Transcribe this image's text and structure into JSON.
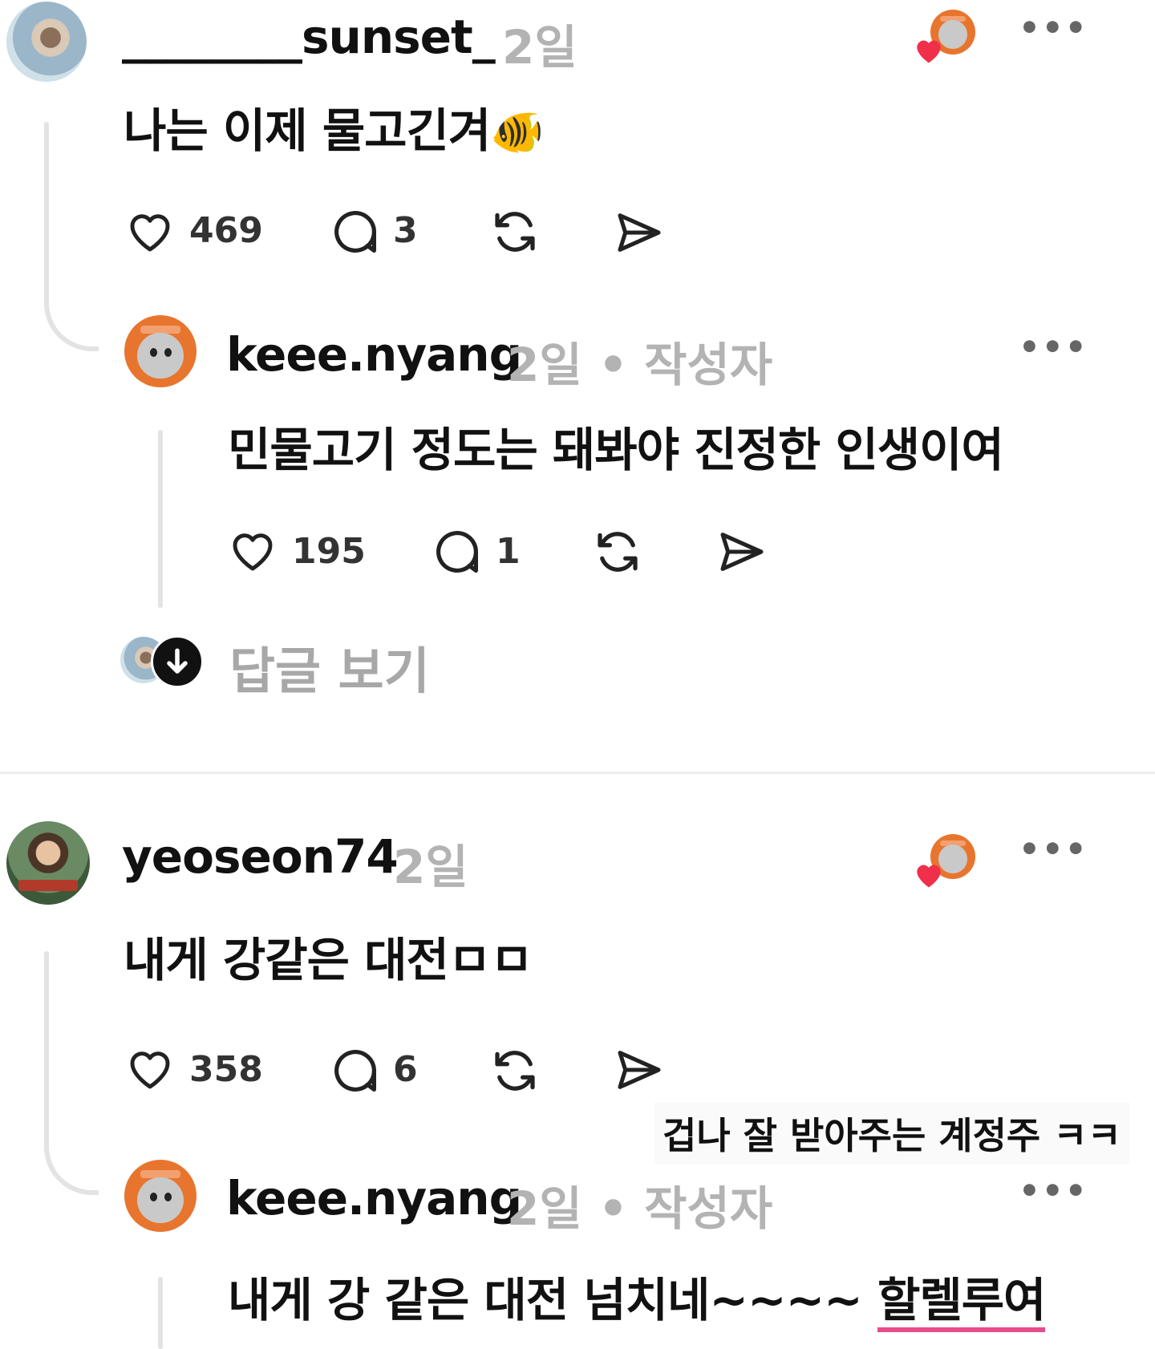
{
  "threads": [
    {
      "username": "________sunset_",
      "time": "2일",
      "text": "나는 이제 물고긴겨",
      "emoji": "🐠",
      "likes": "469",
      "comments": "3",
      "reply": {
        "username": "keee.nyang",
        "meta": "2일 • 작성자",
        "text": "민물고기 정도는 돼봐야 진정한 인생이여",
        "likes": "195",
        "comments": "1"
      },
      "view_replies": "답글 보기"
    },
    {
      "username": "yeoseon74",
      "time": "2일",
      "text": "내게 강같은 대전ㅁㅁ",
      "likes": "358",
      "comments": "6",
      "caption_overlay": "겁나 잘 받아주는 계정주 ㅋㅋ",
      "reply": {
        "username": "keee.nyang",
        "meta": "2일 • 작성자",
        "text_main": "내게 강 같은 대전 넘치네~~~~ ",
        "text_highlight": "할렐루여"
      }
    }
  ],
  "icons": {
    "more": "more-icon",
    "like": "heart-icon",
    "comment": "comment-icon",
    "repost": "repost-icon",
    "share": "send-icon",
    "author_liked": "author-liked-heart-icon",
    "view_replies": "arrow-down-icon"
  },
  "colors": {
    "like_red": "#f0304a",
    "accent_orange": "#e8752e",
    "highlight": "#e84b8a"
  }
}
